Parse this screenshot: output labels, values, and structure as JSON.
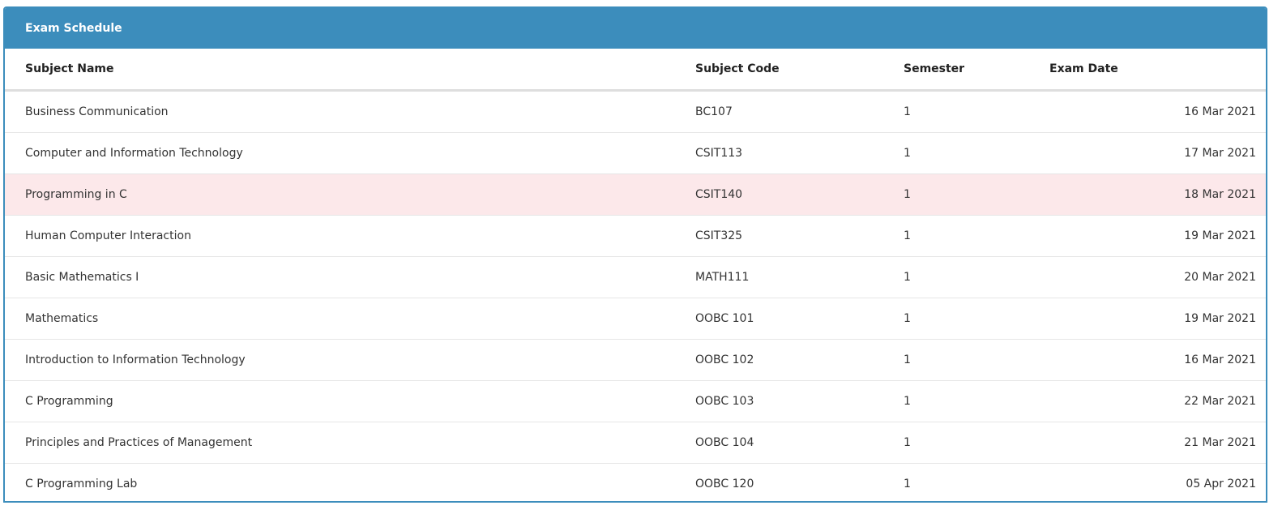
{
  "panel": {
    "title": "Exam Schedule"
  },
  "table": {
    "headers": {
      "subject_name": "Subject Name",
      "subject_code": "Subject Code",
      "semester": "Semester",
      "exam_date": "Exam Date"
    },
    "highlight_color": "#fce8ea",
    "header_color": "#3c8dbc",
    "rows": [
      {
        "name": "Business Communication",
        "code": "BC107",
        "semester": "1",
        "date": "16 Mar 2021",
        "highlighted": false
      },
      {
        "name": "Computer and Information Technology",
        "code": "CSIT113",
        "semester": "1",
        "date": "17 Mar 2021",
        "highlighted": false
      },
      {
        "name": "Programming in C",
        "code": "CSIT140",
        "semester": "1",
        "date": "18 Mar 2021",
        "highlighted": true
      },
      {
        "name": "Human Computer Interaction",
        "code": "CSIT325",
        "semester": "1",
        "date": "19 Mar 2021",
        "highlighted": false
      },
      {
        "name": "Basic Mathematics I",
        "code": "MATH111",
        "semester": "1",
        "date": "20 Mar 2021",
        "highlighted": false
      },
      {
        "name": "Mathematics",
        "code": "OOBC 101",
        "semester": "1",
        "date": "19 Mar 2021",
        "highlighted": false
      },
      {
        "name": "Introduction to Information Technology",
        "code": "OOBC 102",
        "semester": "1",
        "date": "16 Mar 2021",
        "highlighted": false
      },
      {
        "name": "C Programming",
        "code": "OOBC 103",
        "semester": "1",
        "date": "22 Mar 2021",
        "highlighted": false
      },
      {
        "name": "Principles and Practices of Management",
        "code": "OOBC 104",
        "semester": "1",
        "date": "21 Mar 2021",
        "highlighted": false
      },
      {
        "name": "C Programming Lab",
        "code": "OOBC 120",
        "semester": "1",
        "date": "05 Apr 2021",
        "highlighted": false
      }
    ]
  }
}
